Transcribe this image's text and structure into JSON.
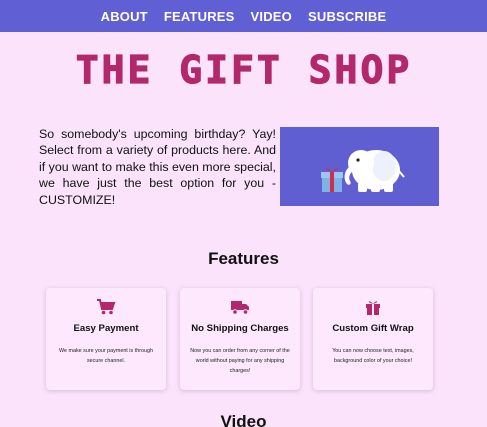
{
  "nav": {
    "items": [
      "ABOUT",
      "FEATURES",
      "VIDEO",
      "SUBSCRIBE"
    ]
  },
  "header": {
    "title": "THE GIFT SHOP",
    "title_color": "#b2286a"
  },
  "intro": {
    "text": "So somebody's upcoming birthday? Yay! Select from a variety of products here. And if you want to make this even more special, we have just the best option for you - CUSTOMIZE!"
  },
  "hero": {
    "image_icon": "elephant-with-gift-icon",
    "background": "#5f5fd2"
  },
  "features": {
    "heading": "Features",
    "cards": [
      {
        "icon": "shopping-cart-icon",
        "title": "Easy Payment",
        "desc": "We make sure your payment is through secure channel."
      },
      {
        "icon": "delivery-truck-icon",
        "title": "No Shipping Charges",
        "desc": "Now you can order from any corner of the world without paying for any shipping charges!"
      },
      {
        "icon": "gift-icon",
        "title": "Custom Gift Wrap",
        "desc": "You can now choose text, images, background color of your choice!"
      }
    ]
  },
  "video": {
    "heading": "Video"
  },
  "colors": {
    "nav_bg": "#6060d4",
    "page_bg": "#fbe3fb",
    "accent": "#b2286a"
  }
}
